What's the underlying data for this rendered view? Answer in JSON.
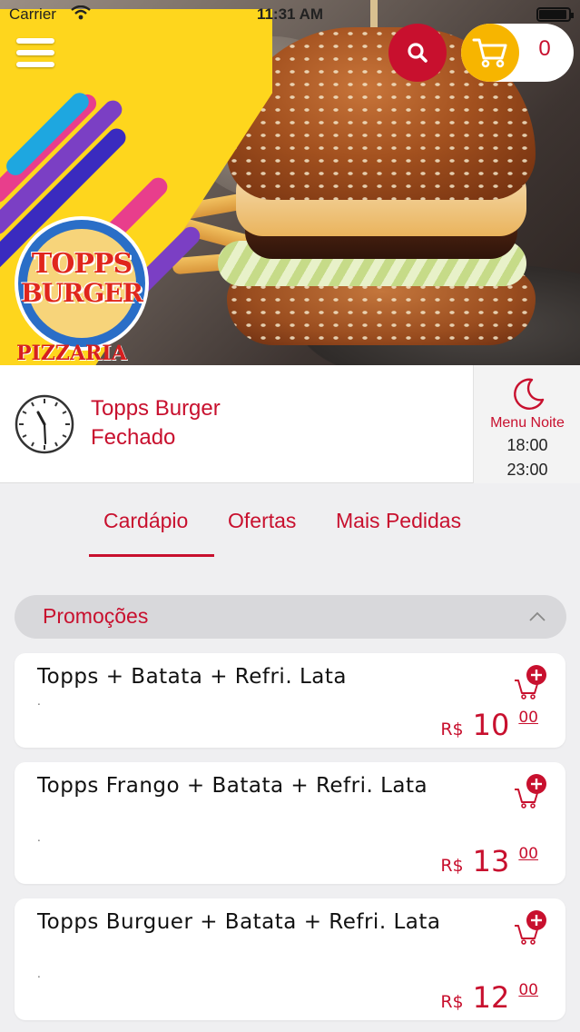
{
  "status_bar": {
    "carrier": "Carrier",
    "time": "11:31 AM",
    "battery_level": 0.95
  },
  "header": {
    "logo_line1": "TOPPS",
    "logo_line2": "BURGER",
    "logo_subtitle": "PIZZARIA",
    "cart_count": "0",
    "icons": {
      "menu": "hamburger-menu-icon",
      "search": "search-icon",
      "cart": "cart-icon"
    },
    "colors": {
      "red": "#c8102e",
      "yellow": "#f7b500"
    }
  },
  "store": {
    "name": "Topps Burger",
    "status": "Fechado",
    "menu_label": "Menu Noite",
    "open_time": "18:00",
    "close_time": "23:00"
  },
  "tabs": [
    {
      "label": "Cardápio",
      "active": true
    },
    {
      "label": "Ofertas",
      "active": false
    },
    {
      "label": "Mais Pedidas",
      "active": false
    }
  ],
  "section": {
    "title": "Promoções",
    "expanded": true
  },
  "products": [
    {
      "name": "Topps + Batata + Refri. Lata",
      "description": ".",
      "currency": "R$",
      "price_int": "10",
      "price_cents": "00"
    },
    {
      "name": "Topps Frango + Batata + Refri. Lata",
      "description": ".",
      "currency": "R$",
      "price_int": "13",
      "price_cents": "00"
    },
    {
      "name": "Topps Burguer + Batata + Refri. Lata",
      "description": ".",
      "currency": "R$",
      "price_int": "12",
      "price_cents": "00"
    }
  ]
}
